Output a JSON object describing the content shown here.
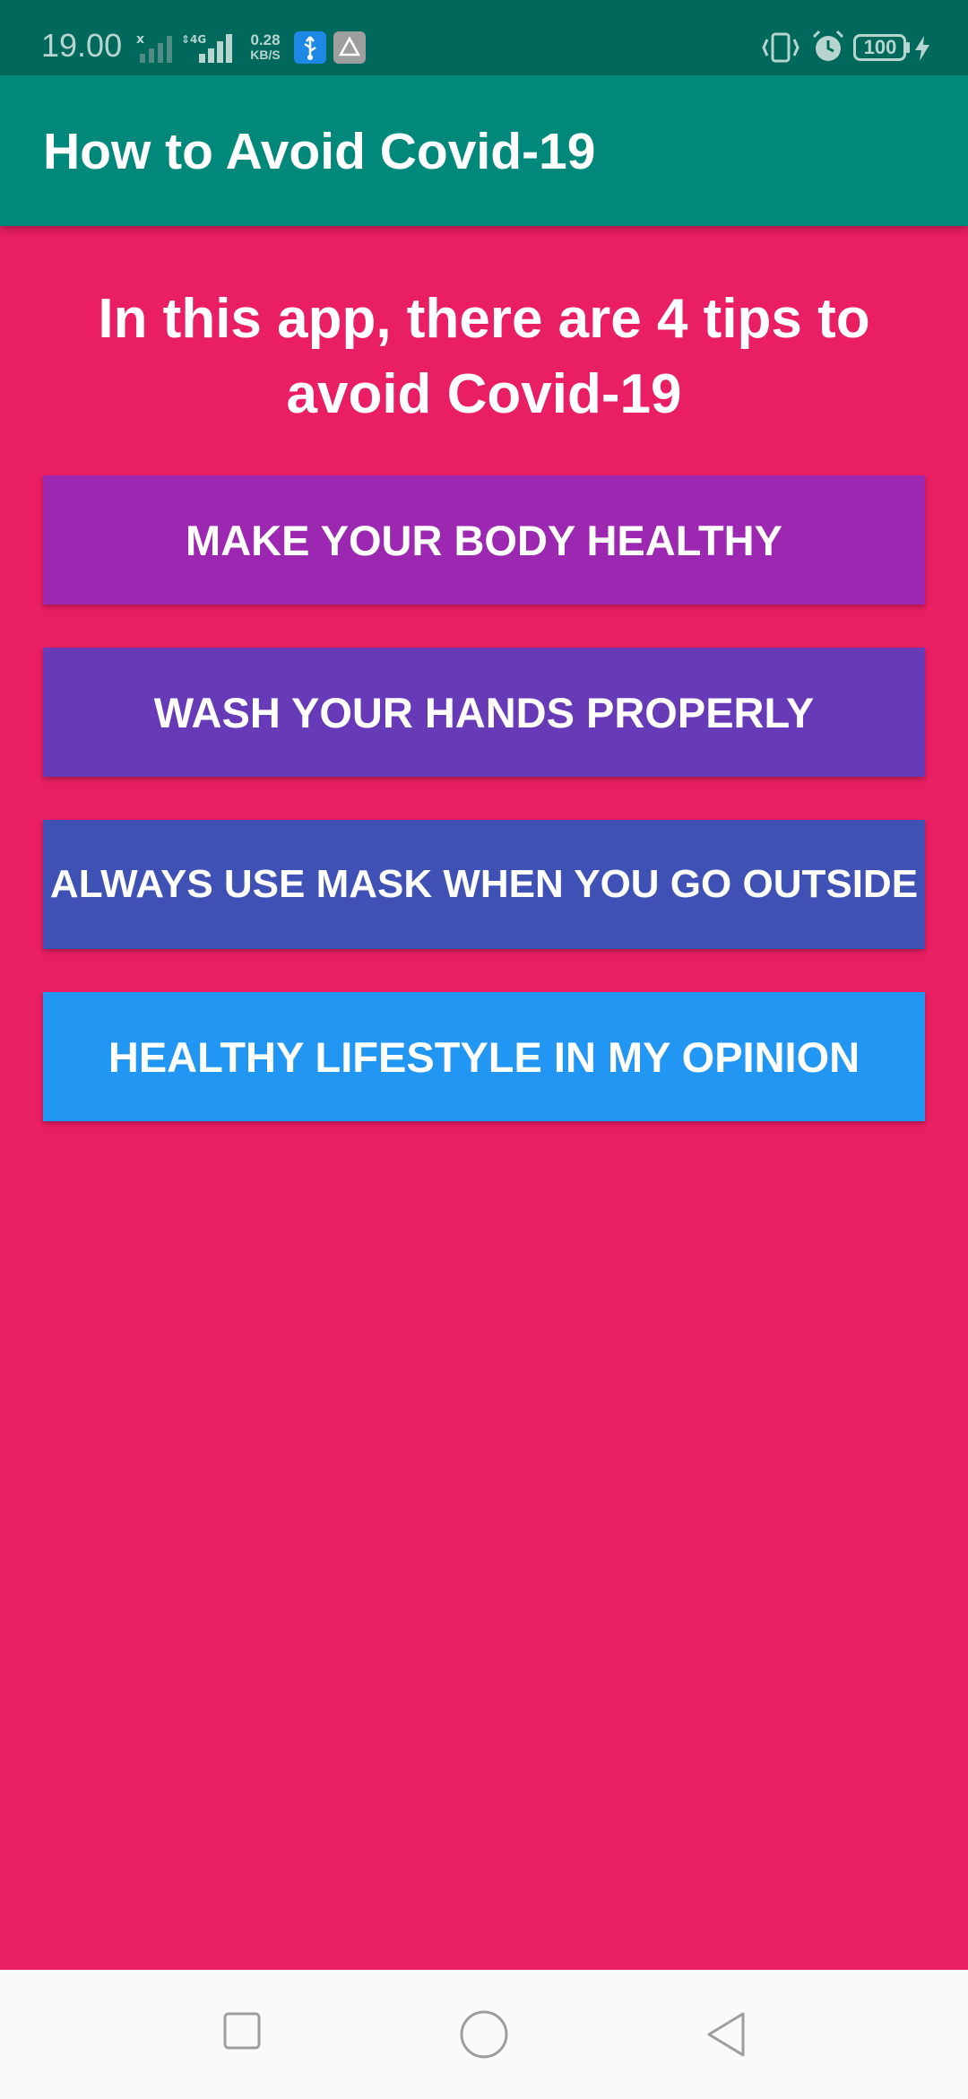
{
  "status_bar": {
    "time": "19.00",
    "network_type": "4G",
    "speed_value": "0.28",
    "speed_unit": "KB/S",
    "battery": "100",
    "icons": [
      "signal-x-icon",
      "signal-4g-icon",
      "usb-icon",
      "app-notification-icon",
      "vibrate-icon",
      "alarm-icon",
      "battery-icon",
      "charging-icon"
    ]
  },
  "app_bar": {
    "title": "How to Avoid Covid-19"
  },
  "main": {
    "heading": "In this app, there are 4 tips to avoid Covid-19",
    "buttons": [
      {
        "label": "MAKE YOUR BODY HEALTHY",
        "color": "#9C27B0"
      },
      {
        "label": "WASH YOUR HANDS PROPERLY",
        "color": "#673AB7"
      },
      {
        "label": "ALWAYS USE MASK WHEN YOU GO OUTSIDE",
        "color": "#3F51B5"
      },
      {
        "label": "HEALTHY LIFESTYLE IN MY OPINION",
        "color": "#2196F3"
      }
    ]
  },
  "nav_bar": {
    "icons": [
      "recents-icon",
      "home-icon",
      "back-icon"
    ]
  },
  "colors": {
    "status_bar": "#00695C",
    "app_bar": "#00897B",
    "background": "#E91E63",
    "nav_bar": "#FAFAFA"
  }
}
